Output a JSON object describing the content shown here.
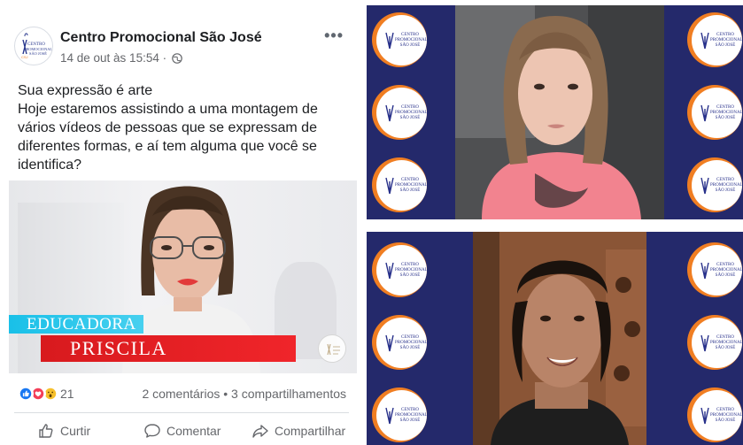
{
  "post": {
    "page_name": "Centro Promocional São José",
    "meta": "14 de out às 15:54 ·",
    "more_label": "•••",
    "text_line1": "Sua expressão é arte",
    "text_line2": "Hoje estaremos assistindo a uma montagem de vários vídeos de pessoas que se expressam de diferentes formas, e aí tem alguma que você se identifica?",
    "video": {
      "lower_third_title": "EDUCADORA",
      "lower_third_name": "PRISCILA"
    },
    "reactions": {
      "icons": [
        "like-icon",
        "love-icon",
        "wow-icon"
      ],
      "count": "21"
    },
    "engagement": "2 comentários • 3 compartilhamentos",
    "actions": {
      "like": "Curtir",
      "comment": "Comentar",
      "share": "Compartilhar"
    }
  },
  "logo_text": [
    "CENTRO",
    "PROMOCIONAL",
    "SÃO JOSÉ"
  ],
  "colors": {
    "facebook_blue": "#1877f2",
    "love_red": "#f33e58",
    "band_cyan": "#19c0e8",
    "band_red": "#e21f23",
    "frame_navy": "#23286a",
    "logo_orange": "#f07e22"
  }
}
